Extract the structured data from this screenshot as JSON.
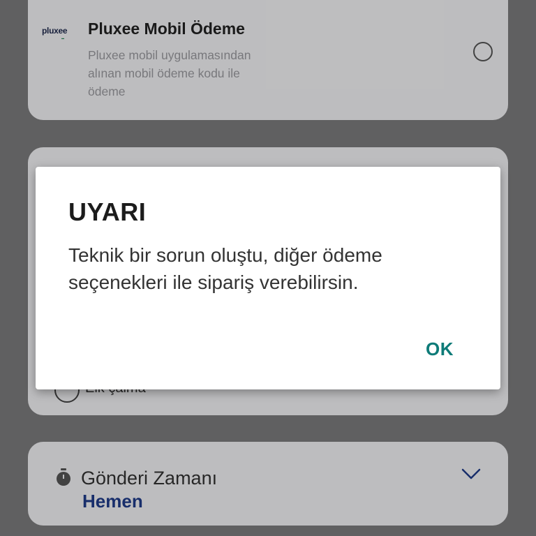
{
  "payment_option": {
    "logo_text": "pluxee",
    "title": "Pluxee Mobil Ödeme",
    "description": "Pluxee mobil uygulamasından\nalınan mobil ödeme kodu ile\nödeme"
  },
  "hidden_option": {
    "label": "Elk çalma"
  },
  "delivery": {
    "label": "Gönderi Zamanı",
    "value": "Hemen",
    "icon": "clock-icon",
    "expand_icon": "chevron-down-icon"
  },
  "dialog": {
    "title": "UYARI",
    "message": "Teknik bir sorun oluştu, diğer ödeme seçenekleri ile sipariş verebilirsin.",
    "ok_label": "OK"
  },
  "colors": {
    "accent": "#0e7b78",
    "value_text": "#1f3b8a"
  }
}
